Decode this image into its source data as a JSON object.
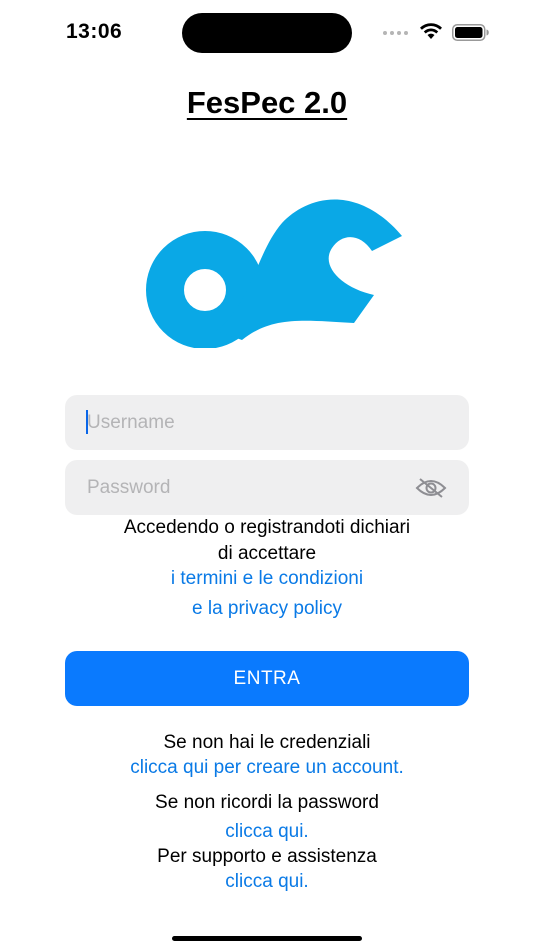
{
  "status_bar": {
    "time": "13:06"
  },
  "app": {
    "title": "FesPec 2.0"
  },
  "form": {
    "username_placeholder": "Username",
    "password_placeholder": "Password",
    "username_value": "",
    "password_value": ""
  },
  "disclaimer": {
    "line1": "Accedendo o registrandoti dichiari",
    "line2": "di accettare",
    "terms_link": "i termini e le condizioni",
    "privacy_link": "e la privacy policy"
  },
  "login_button": "ENTRA",
  "register": {
    "text": "Se non hai le credenziali",
    "link": "clicca qui per creare un account."
  },
  "recover": {
    "text": "Se non ricordi la password",
    "link": "clicca qui."
  },
  "support": {
    "text": "Per supporto e assistenza",
    "link": "clicca qui."
  },
  "icons": {
    "password_toggle": "eye-slash-icon",
    "logo": "fespec-logo"
  },
  "colors": {
    "brand_logo": "#0aa8e6",
    "primary_button": "#0a7afe",
    "link": "#0a7ae6",
    "field_bg": "#efeff0"
  }
}
